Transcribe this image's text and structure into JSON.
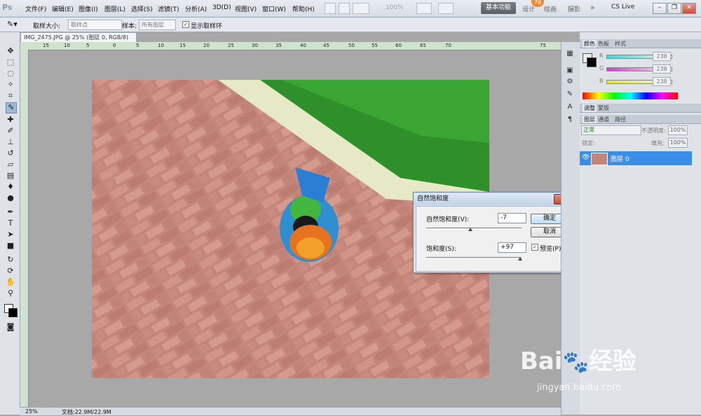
{
  "app": {
    "logo": "Ps",
    "menu": [
      "文件(F)",
      "编辑(E)",
      "图像(I)",
      "图层(L)",
      "选择(S)",
      "滤镜(T)",
      "分析(A)",
      "3D(D)",
      "视图(V)",
      "窗口(W)",
      "帮助(H)"
    ],
    "zoom_level": "100%",
    "workspaces": {
      "active": "基本功能",
      "others": [
        "设计",
        "绘画",
        "摄影"
      ],
      "more": "»"
    },
    "cs_live": "CS Live",
    "notification_count": "76"
  },
  "options_bar": {
    "sample_size_label": "取样大小:",
    "sample_size_value": "取样点",
    "sample_label": "样本:",
    "sample_value": "所有图层",
    "show_ring_label": "显示取样环"
  },
  "document": {
    "tab_title": "IMG_2475.JPG @ 25% (图层 0, RGB/8)",
    "ruler_ticks": [
      "15",
      "10",
      "5",
      "0",
      "5",
      "10",
      "15",
      "20",
      "25",
      "30",
      "35",
      "40",
      "45",
      "50",
      "55",
      "60",
      "65",
      "70",
      "75"
    ],
    "zoom_display": "25%",
    "file_info": "文档:22.9M/22.9M"
  },
  "dialog": {
    "title": "自然饱和度",
    "vibrance_label": "自然饱和度(V):",
    "vibrance_value": "-7",
    "vibrance_level": -7,
    "saturation_label": "饱和度(S):",
    "saturation_value": "+97",
    "saturation_level": 97,
    "ok_label": "确定",
    "cancel_label": "取消",
    "preview_label": "预览(P)",
    "preview_checked": true
  },
  "color_panel": {
    "tabs": [
      "颜色",
      "色板",
      "样式"
    ],
    "channels": [
      {
        "name": "R",
        "value": "238",
        "ramp_color": "#3fd6d6"
      },
      {
        "name": "G",
        "value": "238",
        "ramp_color": "#d23cd2"
      },
      {
        "name": "B",
        "value": "238",
        "ramp_color": "#e6e63c"
      }
    ]
  },
  "adjust_panel": {
    "tabs": [
      "调整",
      "蒙版"
    ]
  },
  "layers_panel": {
    "tabs": [
      "图层",
      "通道",
      "路径"
    ],
    "blend_mode": "正常",
    "opacity_label": "不透明度:",
    "opacity_value": "100%",
    "lock_label": "锁定:",
    "fill_label": "填充:",
    "fill_value": "100%",
    "layer_name": "图层 0"
  },
  "watermark": {
    "brand": "Bai",
    "brand2": "经验",
    "url": "jingyan.baidu.com"
  }
}
